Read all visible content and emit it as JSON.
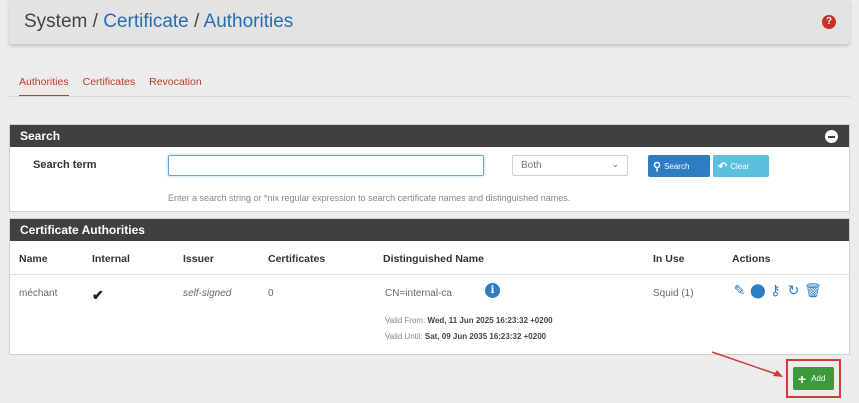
{
  "breadcrumb": {
    "root": "System",
    "sep1": "/",
    "level1": "Certificate",
    "sep2": "/",
    "level2": "Authorities"
  },
  "help_icon": "?",
  "tabs": [
    {
      "label": "Authorities",
      "active": true
    },
    {
      "label": "Certificates",
      "active": false
    },
    {
      "label": "Revocation",
      "active": false
    }
  ],
  "search": {
    "title": "Search",
    "term_label": "Search term",
    "input_value": "",
    "scope_selected": "Both",
    "search_button": "Search",
    "clear_button": "Clear",
    "help": "Enter a search string or *nix regular expression to search certificate names and distinguished names."
  },
  "ca": {
    "title": "Certificate Authorities",
    "columns": [
      "Name",
      "Internal",
      "Issuer",
      "Certificates",
      "Distinguished Name",
      "In Use",
      "Actions"
    ],
    "row": {
      "name": "méchant",
      "internal": true,
      "issuer": "self-signed",
      "certificates": "0",
      "dn": "CN=internal-ca",
      "valid_from_label": "Valid From:",
      "valid_from": "Wed, 11 Jun 2025 16:23:32 +0200",
      "valid_until_label": "Valid Until:",
      "valid_until": "Sat, 09 Jun 2035 16:23:32 +0200",
      "in_use": "Squid (1)",
      "actions": [
        "pencil-icon",
        "export-icon",
        "key-icon",
        "refresh-icon",
        "trash-icon"
      ]
    }
  },
  "add_button": "Add",
  "colors": {
    "header_dark": "#404040",
    "link_blue": "#2e7cc4",
    "tab_red": "#c0392b",
    "add_green": "#3c9a3c",
    "highlight_red": "#d23b3b"
  }
}
